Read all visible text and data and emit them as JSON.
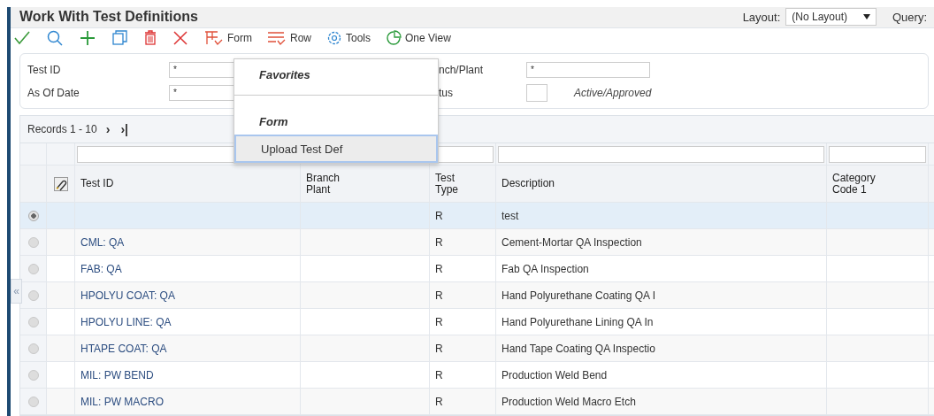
{
  "window": {
    "title": "Work With Test Definitions"
  },
  "layout": {
    "label": "Layout:",
    "value": "(No Layout)"
  },
  "query": {
    "label": "Query:"
  },
  "toolbar": [
    {
      "kind": "check"
    },
    {
      "kind": "search"
    },
    {
      "kind": "add"
    },
    {
      "kind": "copy"
    },
    {
      "kind": "delete"
    },
    {
      "kind": "close"
    },
    {
      "kind": "form",
      "label": "Form"
    },
    {
      "kind": "row",
      "label": "Row"
    },
    {
      "kind": "tools",
      "label": "Tools"
    },
    {
      "kind": "oneview",
      "label": "One View"
    }
  ],
  "filters": [
    {
      "label": "Test ID",
      "value": "*"
    },
    {
      "label": "As Of Date",
      "value": "*"
    },
    {
      "label": "nch/Plant",
      "value": "*"
    },
    {
      "label": "tus",
      "note": "Active/Approved"
    }
  ],
  "grid": {
    "records": "Records 1 - 10",
    "next": "›",
    "last": "›|",
    "columns": [
      "Test ID",
      "Branch\nPlant",
      "Test\nType",
      "Description",
      "Category\nCode 1"
    ],
    "rows": [
      {
        "selected": true,
        "test_id": "",
        "test_type": "R",
        "description": "test"
      },
      {
        "selected": false,
        "test_id": "CML: QA",
        "test_type": "R",
        "description": "Cement-Mortar QA Inspection"
      },
      {
        "selected": false,
        "test_id": "FAB: QA",
        "test_type": "R",
        "description": "Fab QA Inspection"
      },
      {
        "selected": false,
        "test_id": "HPOLYU COAT: QA",
        "test_type": "R",
        "description": "Hand Polyurethane Coating QA I"
      },
      {
        "selected": false,
        "test_id": "HPOLYU LINE: QA",
        "test_type": "R",
        "description": "Hand Polyurethane Lining QA In"
      },
      {
        "selected": false,
        "test_id": "HTAPE COAT: QA",
        "test_type": "R",
        "description": "Hand Tape Coating QA Inspectio"
      },
      {
        "selected": false,
        "test_id": "MIL: PW BEND",
        "test_type": "R",
        "description": "Production Weld Bend"
      },
      {
        "selected": false,
        "test_id": "MIL: PW MACRO",
        "test_type": "R",
        "description": "Production Weld Macro Etch"
      }
    ]
  },
  "menu": {
    "items": [
      {
        "kind": "heading",
        "label": "Favorites"
      },
      {
        "kind": "separator"
      },
      {
        "kind": "heading",
        "label": "Form"
      },
      {
        "kind": "item",
        "label": "Upload Test Def",
        "highlighted": true
      }
    ]
  },
  "collapse_tab": "«"
}
